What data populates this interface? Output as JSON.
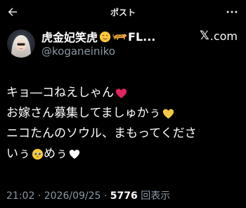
{
  "header": {
    "title": "ポスト",
    "back_icon": "arrow-left-icon",
    "more_icon": "more-horizontal-icon"
  },
  "author": {
    "display_name": "虎金妃笑虎",
    "display_name_suffix": "FL...",
    "handle": "@koganeiniko",
    "source_label": ".com",
    "source_mark": "𝕏"
  },
  "tweet": {
    "lines": [
      "キョ―コねえしゃん",
      "お嫁さん募集してましゅかぅ",
      "ニコたんのソウル、まもってくださ",
      "いぅ",
      "めぅ"
    ]
  },
  "meta": {
    "time": "21:02",
    "separator": "·",
    "date": "2026/09/25",
    "views_count": "5776",
    "views_label": "回表示"
  },
  "colors": {
    "background": "#000000",
    "text": "#ffffff",
    "secondary": "#8b98a5",
    "heart_red": "#e0245e",
    "heart_yellow": "#f5c842",
    "heart_white": "#ffffff"
  }
}
